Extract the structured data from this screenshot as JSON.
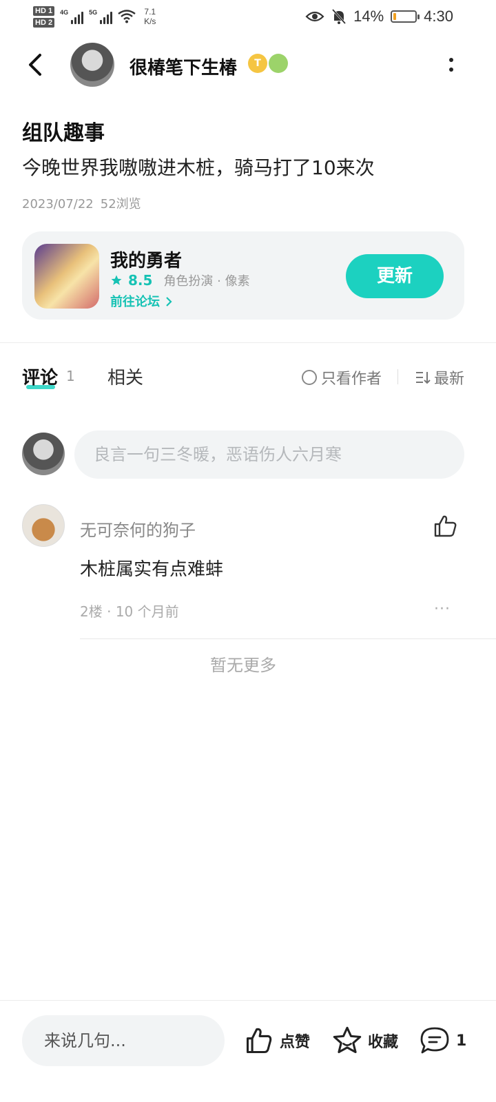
{
  "status_bar": {
    "hd1": "HD 1",
    "hd2": "HD 2",
    "sim1": "4G",
    "sim2": "5G",
    "speed_value": "7.1",
    "speed_unit": "K/s",
    "battery_text": "14%",
    "battery_level": 0.14,
    "battery_color": "#f0a020",
    "time": "4:30",
    "icons": [
      "hd-icon",
      "signal-icon",
      "wifi-icon",
      "eye-icon",
      "mute-bell-icon",
      "battery-icon"
    ]
  },
  "header": {
    "username": "很椿笔下生椿",
    "coin_badge": "T"
  },
  "post": {
    "title": "组队趣事",
    "body": "今晚世界我嗷嗷进木桩，骑马打了10来次",
    "date": "2023/07/22",
    "views": "52浏览"
  },
  "game_card": {
    "name": "我的勇者",
    "rating": "8.5",
    "tags": "角色扮演 · 像素",
    "link": "前往论坛",
    "button": "更新",
    "accent": "#1cd1c0"
  },
  "tabs": {
    "comment": "评论",
    "comment_count": "1",
    "related": "相关",
    "author_only": "只看作者",
    "sort": "最新"
  },
  "comment_input": {
    "placeholder": "良言一句三冬暖，恶语伤人六月寒"
  },
  "comments": [
    {
      "user": "无可奈何的狗子",
      "text": "木桩属实有点难蚌",
      "floor": "2楼",
      "time": "10 个月前",
      "more": "···"
    }
  ],
  "no_more": "暂无更多",
  "bottom_bar": {
    "placeholder": "来说几句...",
    "like": "点赞",
    "favorite": "收藏",
    "comment_count": "1"
  }
}
